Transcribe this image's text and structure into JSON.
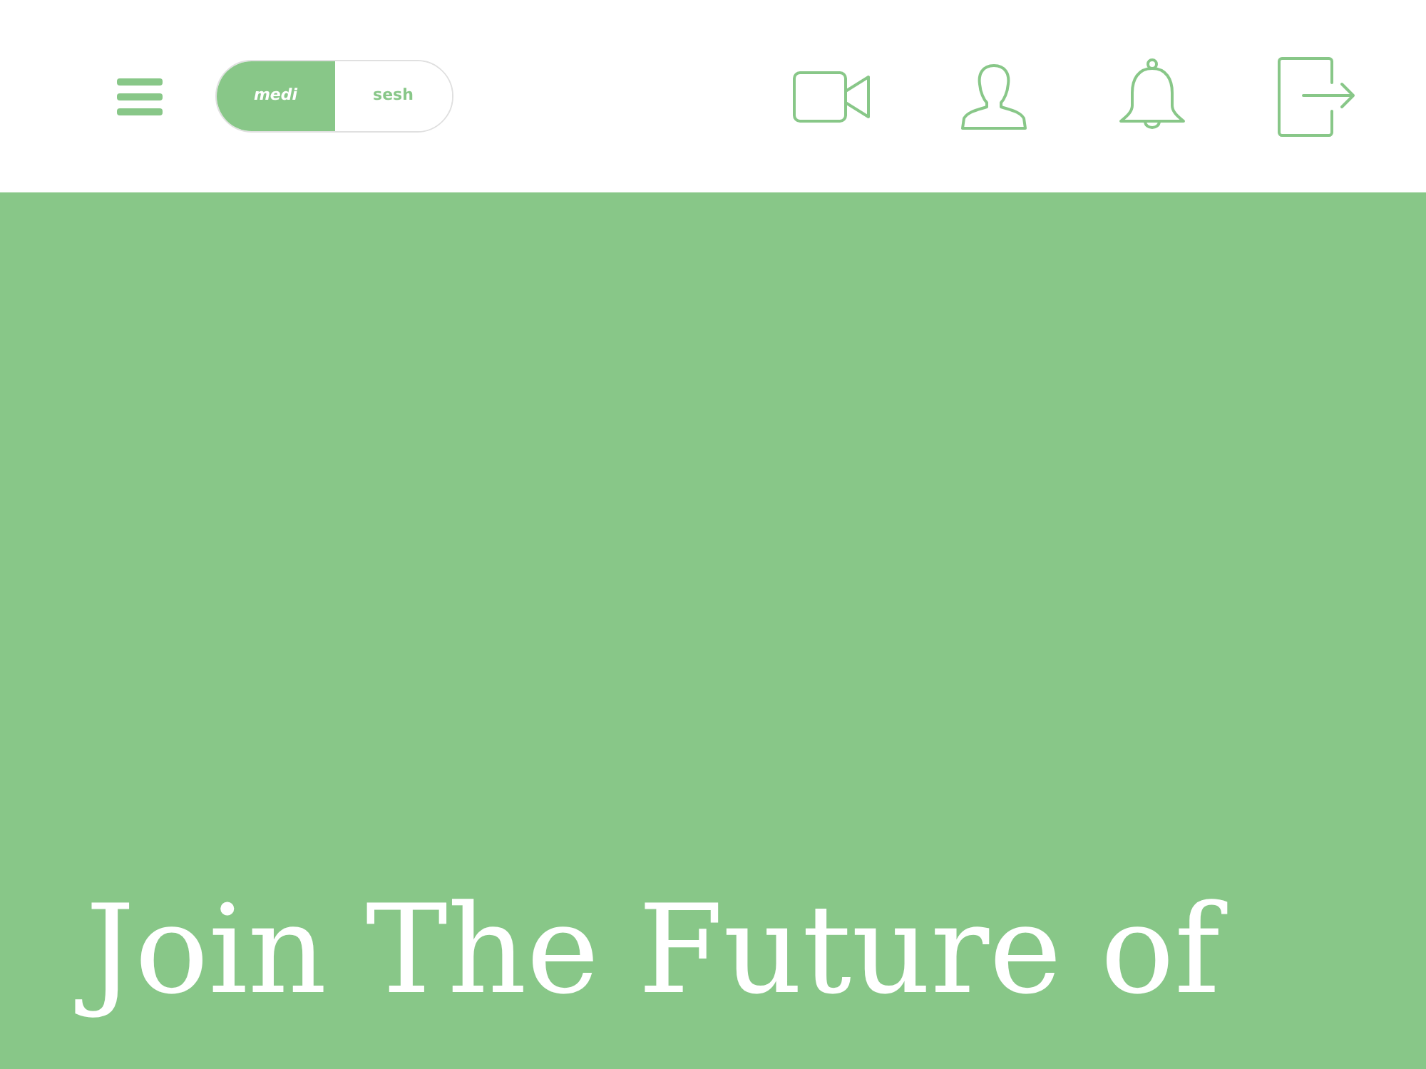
{
  "header": {
    "mode_toggle": [
      {
        "label": "medi",
        "selected": true
      },
      {
        "label": "sesh",
        "selected": false
      }
    ]
  },
  "hero": {
    "heading": "Join The Future of"
  }
}
